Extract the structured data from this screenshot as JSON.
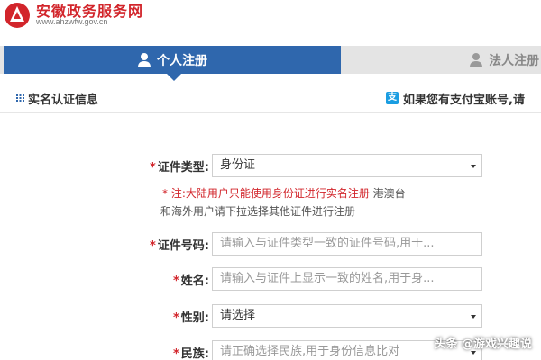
{
  "header": {
    "site_title": "安徽政务服务网",
    "site_url": "www.ahzwfw.gov.cn"
  },
  "tabs": [
    {
      "label": "个人注册",
      "active": true
    },
    {
      "label": "法人注册",
      "active": false
    }
  ],
  "section": {
    "title": "实名认证信息",
    "alipay_prompt": "如果您有支付宝账号,请"
  },
  "form": {
    "id_type": {
      "label": "证件类型:",
      "value": "身份证"
    },
    "note": {
      "red": "* 注:大陆用户只能使用身份证进行实名注册",
      "gray": " 港澳台",
      "line2": "和海外用户请下拉选择其他证件进行注册"
    },
    "id_number": {
      "label": "证件号码:",
      "placeholder": "请输入与证件类型一致的证件号码,用于..."
    },
    "name": {
      "label": "姓名:",
      "placeholder": "请输入与证件上显示一致的姓名,用于身..."
    },
    "gender": {
      "label": "性别:",
      "value": "请选择"
    },
    "ethnicity": {
      "label": "民族:",
      "placeholder": "请正确选择民族,用于身份信息比对"
    }
  },
  "watermark": "头条 @游戏兴趣说",
  "colors": {
    "brand_red": "#d2252b",
    "tab_blue": "#2f67ad",
    "alipay_blue": "#1a9de1"
  }
}
